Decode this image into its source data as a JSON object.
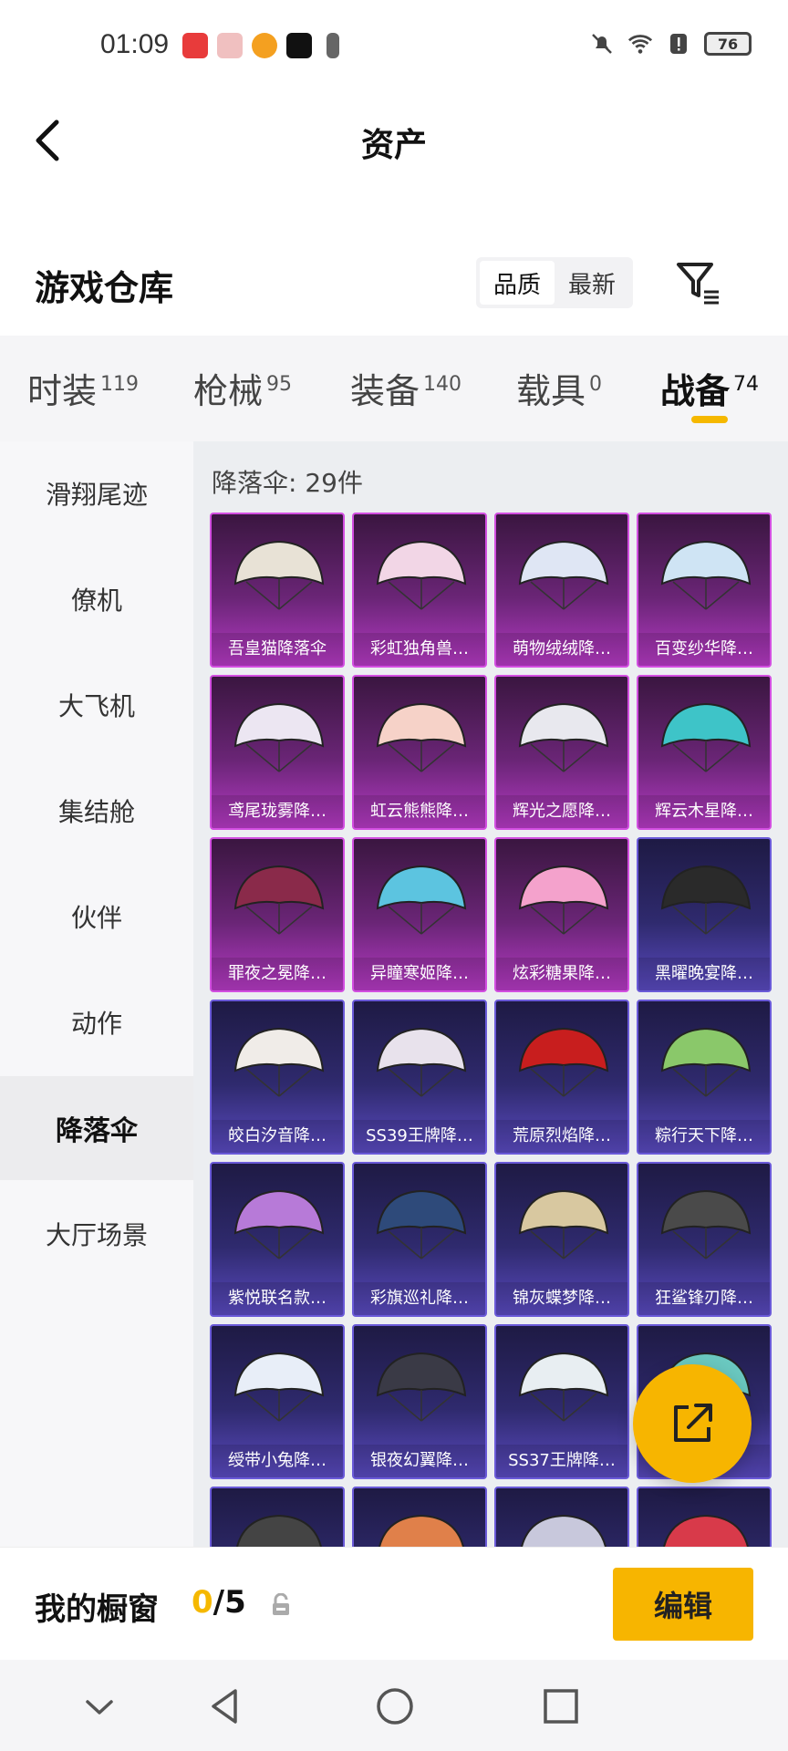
{
  "status_bar": {
    "time": "01:09",
    "battery": "76",
    "app_colors": [
      "#e83b3b",
      "#e86b6b",
      "#f4a020",
      "#111111",
      "#666666"
    ]
  },
  "header": {
    "title": "资产",
    "back_icon": "chevron-left-icon"
  },
  "warehouse": {
    "title": "游戏仓库",
    "sort_options": [
      "品质",
      "最新"
    ],
    "active_sort": "品质",
    "filter_icon": "filter-icon"
  },
  "tabs": [
    {
      "label": "时装",
      "count": "119"
    },
    {
      "label": "枪械",
      "count": "95"
    },
    {
      "label": "装备",
      "count": "140"
    },
    {
      "label": "载具",
      "count": "0"
    },
    {
      "label": "战备",
      "count": "74",
      "active": true
    }
  ],
  "sidebar": {
    "items": [
      "滑翔尾迹",
      "僚机",
      "大飞机",
      "集结舱",
      "伙伴",
      "动作",
      "降落伞",
      "大厅场景"
    ],
    "active": "降落伞"
  },
  "content": {
    "count_label": "降落伞: 29件",
    "items": [
      {
        "label": "吾皇猫降落伞",
        "tier": "pink",
        "color": "#e8e2d6"
      },
      {
        "label": "彩虹独角兽…",
        "tier": "pink",
        "color": "#f2d6e6"
      },
      {
        "label": "萌物绒绒降…",
        "tier": "pink",
        "color": "#dfe6f4"
      },
      {
        "label": "百变纱华降…",
        "tier": "pink",
        "color": "#cfe4f4"
      },
      {
        "label": "鸢尾珑雾降…",
        "tier": "pink",
        "color": "#ece6f2"
      },
      {
        "label": "虹云熊熊降…",
        "tier": "pink",
        "color": "#f6d2c8"
      },
      {
        "label": "辉光之愿降…",
        "tier": "pink",
        "color": "#e8e8ee"
      },
      {
        "label": "辉云木星降…",
        "tier": "pink",
        "color": "#3ec4c8"
      },
      {
        "label": "罪夜之冕降…",
        "tier": "pink",
        "color": "#8a2a4a"
      },
      {
        "label": "异瞳寒姬降…",
        "tier": "pink",
        "color": "#5cc4e0"
      },
      {
        "label": "炫彩糖果降…",
        "tier": "pink",
        "color": "#f4a2cc"
      },
      {
        "label": "黑曜晚宴降…",
        "tier": "purple",
        "color": "#2a2a2a"
      },
      {
        "label": "皎白汐音降…",
        "tier": "purple",
        "color": "#f0ece8"
      },
      {
        "label": "SS39王牌降…",
        "tier": "purple",
        "color": "#e8e2ec"
      },
      {
        "label": "荒原烈焰降…",
        "tier": "purple",
        "color": "#c81e1e"
      },
      {
        "label": "粽行天下降…",
        "tier": "purple",
        "color": "#8ac86a"
      },
      {
        "label": "紫悦联名款…",
        "tier": "purple",
        "color": "#b77ad8"
      },
      {
        "label": "彩旗巡礼降…",
        "tier": "purple",
        "color": "#2e4a7a"
      },
      {
        "label": "锦灰蝶梦降…",
        "tier": "purple",
        "color": "#d8c8a0"
      },
      {
        "label": "狂鲨锋刃降…",
        "tier": "purple",
        "color": "#4a4a4a"
      },
      {
        "label": "绶带小兔降…",
        "tier": "purple",
        "color": "#e8eef8"
      },
      {
        "label": "银夜幻翼降…",
        "tier": "purple",
        "color": "#3a3a46"
      },
      {
        "label": "SS37王牌降…",
        "tier": "purple",
        "color": "#e8eef2"
      },
      {
        "label": "",
        "tier": "purple",
        "color": "#6ac8c0"
      },
      {
        "label": "",
        "tier": "purple",
        "color": "#444444"
      },
      {
        "label": "",
        "tier": "purple",
        "color": "#e0804a"
      },
      {
        "label": "",
        "tier": "purple",
        "color": "#c8c8dc"
      },
      {
        "label": "",
        "tier": "purple",
        "color": "#d83a4a"
      }
    ]
  },
  "fab": {
    "icon": "share-icon"
  },
  "showcase": {
    "title": "我的橱窗",
    "count_current": "0",
    "count_total": "/5",
    "lock_icon": "lock-icon",
    "edit_label": "编辑"
  },
  "system_nav": {
    "icons": [
      "chevron-down-icon",
      "back-triangle-icon",
      "home-circle-icon",
      "recents-square-icon"
    ]
  },
  "colors": {
    "accent": "#f7b500",
    "pink_tier": "#d24ee0",
    "purple_tier": "#6a5ad8"
  }
}
